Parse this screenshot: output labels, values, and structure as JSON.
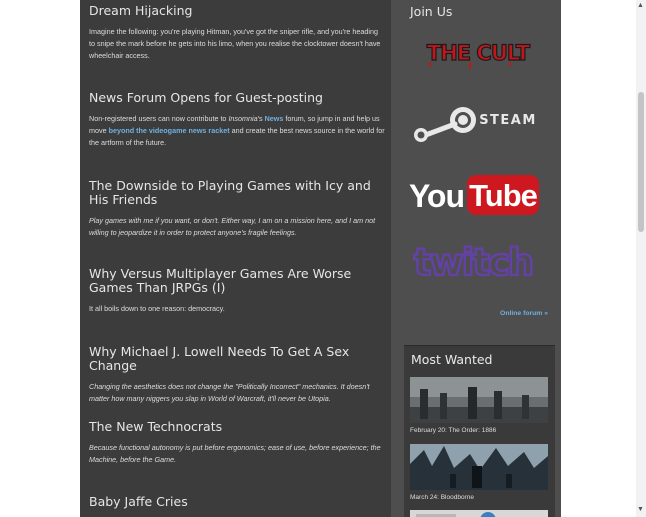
{
  "posts": [
    {
      "title": "Dream Hijacking",
      "excerpt": "Imagine the following: you're playing Hitman, you've got the sniper rifle, and you're heading to snipe the mark before he gets into his limo, when you realise the clocktower doesn't have wheelchair access."
    },
    {
      "title": "News Forum Opens for Guest-posting",
      "excerpt_a": "Non-registered users can now contribute to ",
      "excerpt_b": "Insomnia",
      "excerpt_c": "'s ",
      "link1": "News",
      "excerpt_d": " forum, so jump in and help us move ",
      "link2": "beyond the videogame news racket",
      "excerpt_e": " and create the best news source in the world for the artform of the future."
    },
    {
      "title": "The Downside to Playing Games with Icy and His Friends",
      "excerpt": "Play games with me if you want, or don't. Either way, I am on a mission here, and I am not willing to jeopardize it in order to protect anyone's fragile feelings."
    },
    {
      "title": "Why Versus Multiplayer Games Are Worse Games Than JRPGs (I)",
      "excerpt": "It all boils down to one reason: democracy."
    },
    {
      "title": "Why Michael J. Lowell Needs To Get A Sex Change",
      "excerpt": "Changing the aesthetics does not change the \"Politically Incorrect\" mechanics. It doesn't matter how many niggers you slap in World of Warcraft, it'll never be Utopia."
    },
    {
      "title": "The New Technocrats",
      "excerpt": "Because functional autonomy is put before ergonomics; ease of use, before experience; the Machine, before the Game."
    },
    {
      "title": "Baby Jaffe Cries"
    }
  ],
  "sidebar": {
    "join_title": "Join Us",
    "logos": {
      "cult": "THE CULT",
      "steam": "STEAM",
      "youtube_you": "You",
      "youtube_tube": "Tube",
      "twitch": "twitch"
    },
    "online_forum": "Online forum »",
    "most_wanted": {
      "title": "Most Wanted",
      "items": [
        {
          "caption": "February 20: The Order: 1886"
        },
        {
          "caption": "March 24: Bloodborne"
        }
      ]
    }
  },
  "colors": {
    "link": "#6fb0e0",
    "cult_red": "#c0161c",
    "youtube_red": "#cc181e",
    "twitch_purple": "#6441a5"
  }
}
